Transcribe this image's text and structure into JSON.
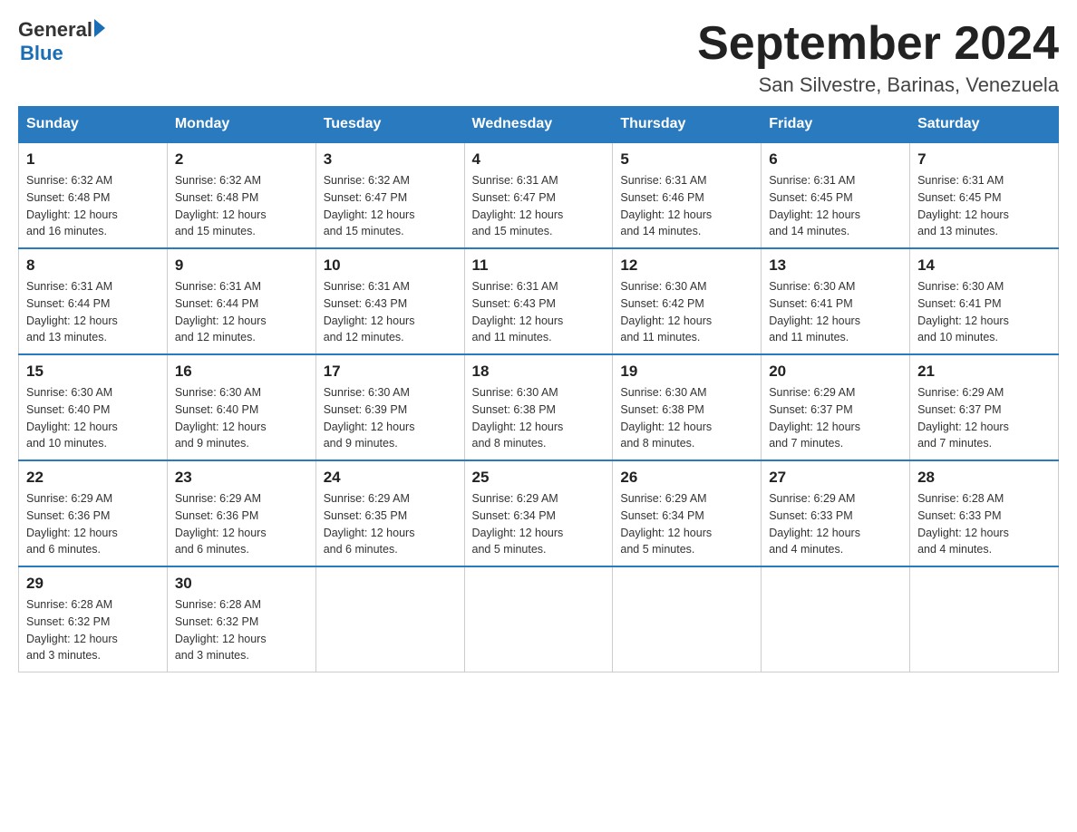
{
  "header": {
    "title": "September 2024",
    "subtitle": "San Silvestre, Barinas, Venezuela"
  },
  "days_of_week": [
    "Sunday",
    "Monday",
    "Tuesday",
    "Wednesday",
    "Thursday",
    "Friday",
    "Saturday"
  ],
  "weeks": [
    [
      {
        "date": "1",
        "sunrise": "6:32 AM",
        "sunset": "6:48 PM",
        "daylight": "12 hours and 16 minutes."
      },
      {
        "date": "2",
        "sunrise": "6:32 AM",
        "sunset": "6:48 PM",
        "daylight": "12 hours and 15 minutes."
      },
      {
        "date": "3",
        "sunrise": "6:32 AM",
        "sunset": "6:47 PM",
        "daylight": "12 hours and 15 minutes."
      },
      {
        "date": "4",
        "sunrise": "6:31 AM",
        "sunset": "6:47 PM",
        "daylight": "12 hours and 15 minutes."
      },
      {
        "date": "5",
        "sunrise": "6:31 AM",
        "sunset": "6:46 PM",
        "daylight": "12 hours and 14 minutes."
      },
      {
        "date": "6",
        "sunrise": "6:31 AM",
        "sunset": "6:45 PM",
        "daylight": "12 hours and 14 minutes."
      },
      {
        "date": "7",
        "sunrise": "6:31 AM",
        "sunset": "6:45 PM",
        "daylight": "12 hours and 13 minutes."
      }
    ],
    [
      {
        "date": "8",
        "sunrise": "6:31 AM",
        "sunset": "6:44 PM",
        "daylight": "12 hours and 13 minutes."
      },
      {
        "date": "9",
        "sunrise": "6:31 AM",
        "sunset": "6:44 PM",
        "daylight": "12 hours and 12 minutes."
      },
      {
        "date": "10",
        "sunrise": "6:31 AM",
        "sunset": "6:43 PM",
        "daylight": "12 hours and 12 minutes."
      },
      {
        "date": "11",
        "sunrise": "6:31 AM",
        "sunset": "6:43 PM",
        "daylight": "12 hours and 11 minutes."
      },
      {
        "date": "12",
        "sunrise": "6:30 AM",
        "sunset": "6:42 PM",
        "daylight": "12 hours and 11 minutes."
      },
      {
        "date": "13",
        "sunrise": "6:30 AM",
        "sunset": "6:41 PM",
        "daylight": "12 hours and 11 minutes."
      },
      {
        "date": "14",
        "sunrise": "6:30 AM",
        "sunset": "6:41 PM",
        "daylight": "12 hours and 10 minutes."
      }
    ],
    [
      {
        "date": "15",
        "sunrise": "6:30 AM",
        "sunset": "6:40 PM",
        "daylight": "12 hours and 10 minutes."
      },
      {
        "date": "16",
        "sunrise": "6:30 AM",
        "sunset": "6:40 PM",
        "daylight": "12 hours and 9 minutes."
      },
      {
        "date": "17",
        "sunrise": "6:30 AM",
        "sunset": "6:39 PM",
        "daylight": "12 hours and 9 minutes."
      },
      {
        "date": "18",
        "sunrise": "6:30 AM",
        "sunset": "6:38 PM",
        "daylight": "12 hours and 8 minutes."
      },
      {
        "date": "19",
        "sunrise": "6:30 AM",
        "sunset": "6:38 PM",
        "daylight": "12 hours and 8 minutes."
      },
      {
        "date": "20",
        "sunrise": "6:29 AM",
        "sunset": "6:37 PM",
        "daylight": "12 hours and 7 minutes."
      },
      {
        "date": "21",
        "sunrise": "6:29 AM",
        "sunset": "6:37 PM",
        "daylight": "12 hours and 7 minutes."
      }
    ],
    [
      {
        "date": "22",
        "sunrise": "6:29 AM",
        "sunset": "6:36 PM",
        "daylight": "12 hours and 6 minutes."
      },
      {
        "date": "23",
        "sunrise": "6:29 AM",
        "sunset": "6:36 PM",
        "daylight": "12 hours and 6 minutes."
      },
      {
        "date": "24",
        "sunrise": "6:29 AM",
        "sunset": "6:35 PM",
        "daylight": "12 hours and 6 minutes."
      },
      {
        "date": "25",
        "sunrise": "6:29 AM",
        "sunset": "6:34 PM",
        "daylight": "12 hours and 5 minutes."
      },
      {
        "date": "26",
        "sunrise": "6:29 AM",
        "sunset": "6:34 PM",
        "daylight": "12 hours and 5 minutes."
      },
      {
        "date": "27",
        "sunrise": "6:29 AM",
        "sunset": "6:33 PM",
        "daylight": "12 hours and 4 minutes."
      },
      {
        "date": "28",
        "sunrise": "6:28 AM",
        "sunset": "6:33 PM",
        "daylight": "12 hours and 4 minutes."
      }
    ],
    [
      {
        "date": "29",
        "sunrise": "6:28 AM",
        "sunset": "6:32 PM",
        "daylight": "12 hours and 3 minutes."
      },
      {
        "date": "30",
        "sunrise": "6:28 AM",
        "sunset": "6:32 PM",
        "daylight": "12 hours and 3 minutes."
      },
      null,
      null,
      null,
      null,
      null
    ]
  ],
  "labels": {
    "sunrise": "Sunrise:",
    "sunset": "Sunset:",
    "daylight": "Daylight:"
  }
}
